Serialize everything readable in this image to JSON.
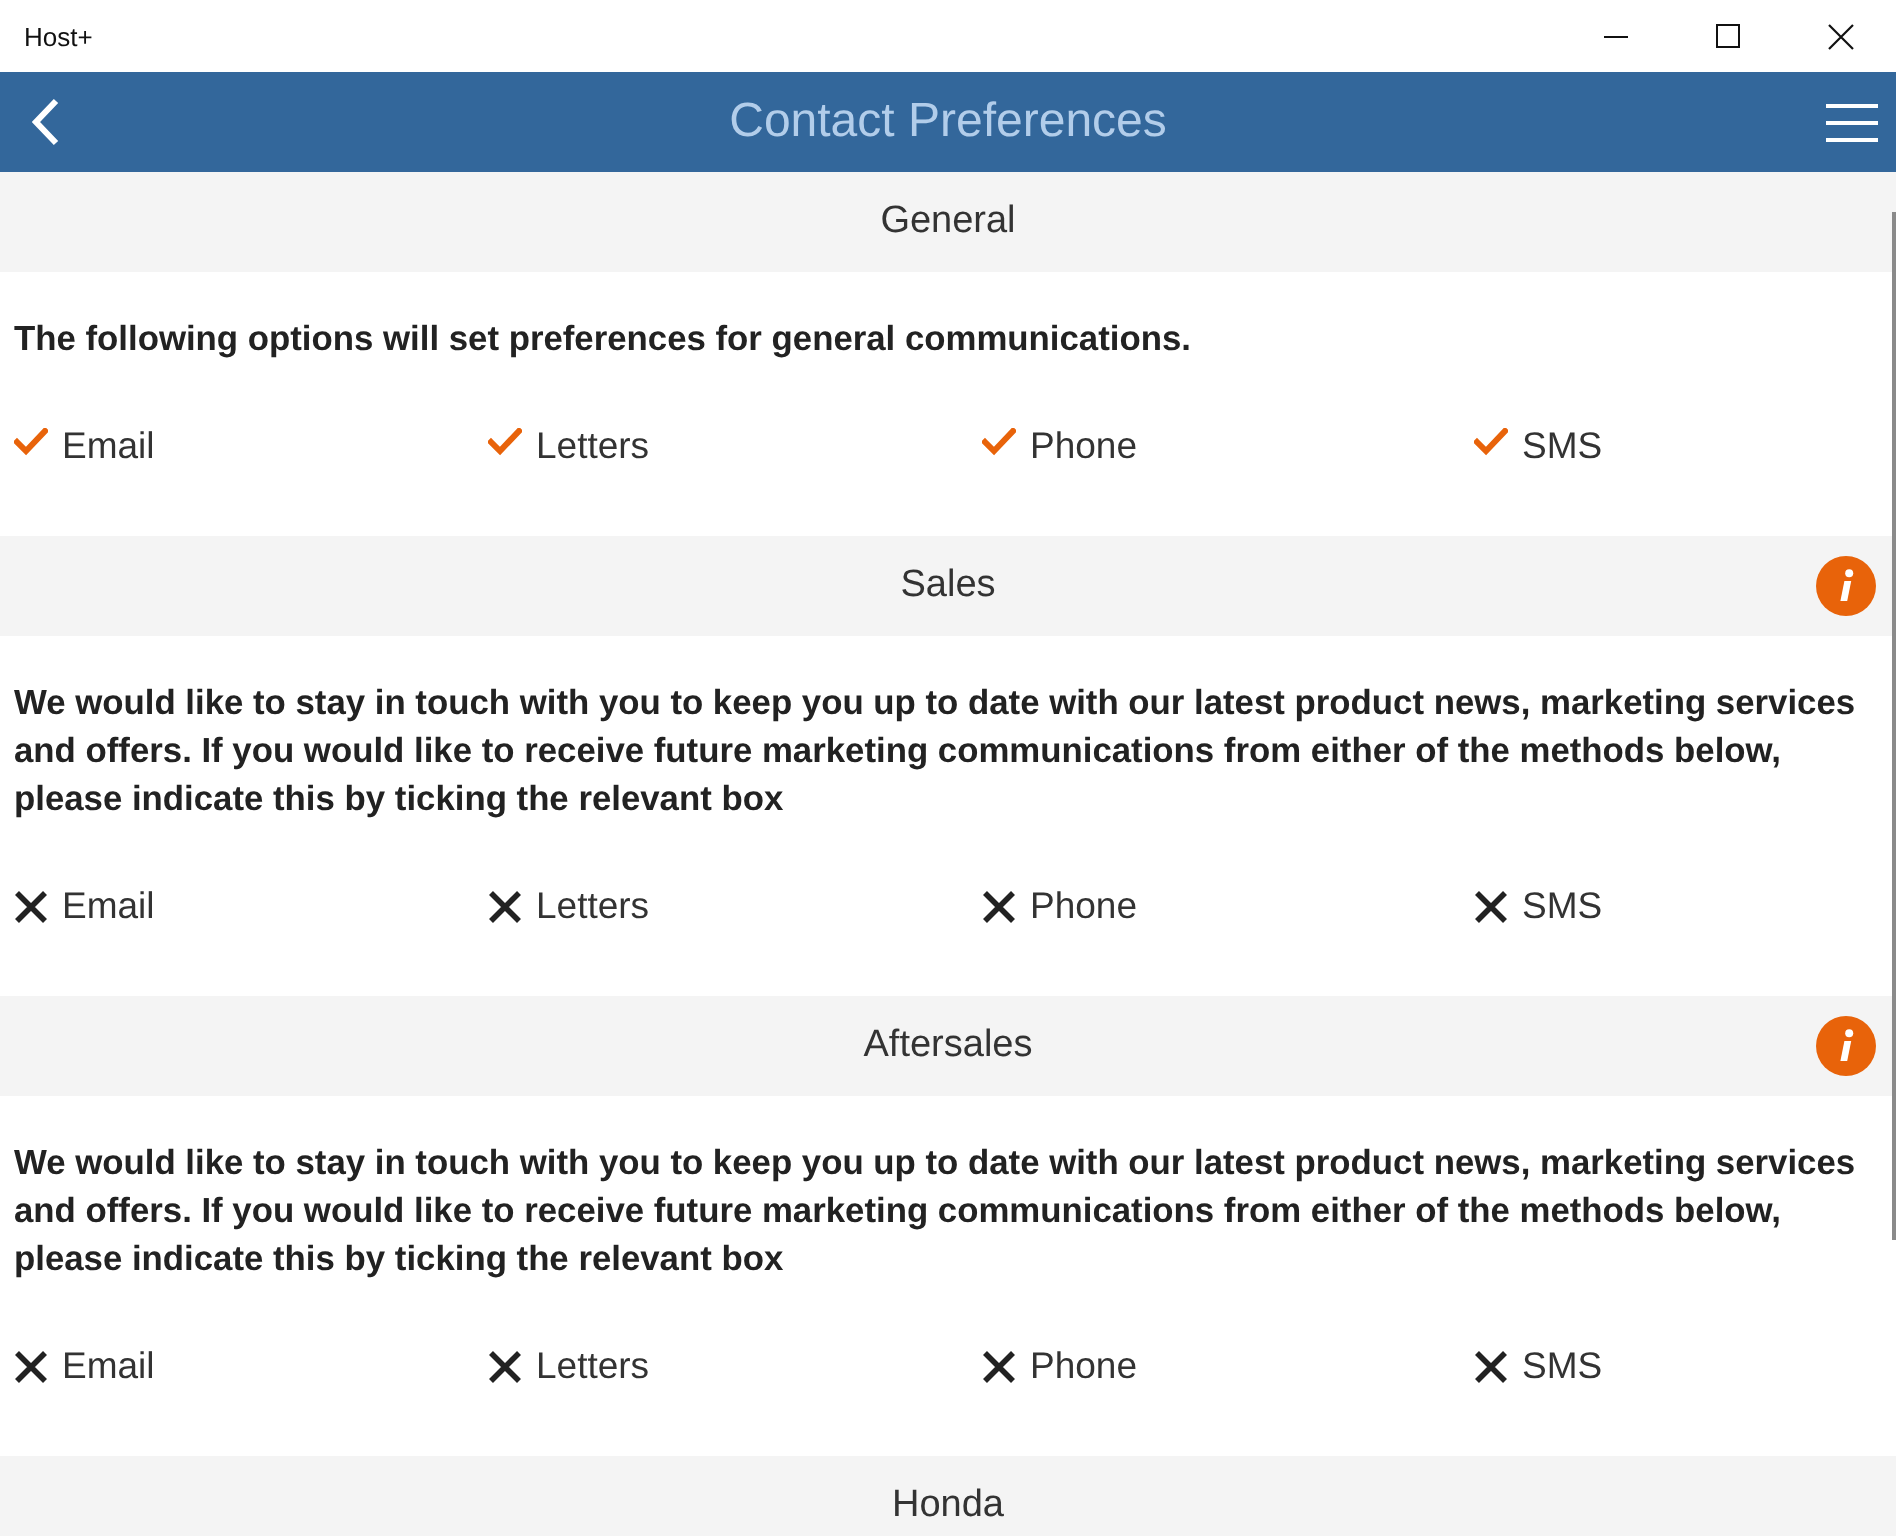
{
  "window": {
    "title": "Host+"
  },
  "header": {
    "title": "Contact Preferences"
  },
  "sections": [
    {
      "title": "General",
      "info": false,
      "description": "The following options will set preferences for general communications.",
      "options": [
        {
          "label": "Email",
          "checked": true
        },
        {
          "label": "Letters",
          "checked": true
        },
        {
          "label": "Phone",
          "checked": true
        },
        {
          "label": "SMS",
          "checked": true
        }
      ]
    },
    {
      "title": "Sales",
      "info": true,
      "description": "We would like to stay in touch with you to keep you up to date with our latest product news, marketing services and offers. If you would like to receive future marketing communications from either of the methods below, please indicate this by ticking the relevant box",
      "options": [
        {
          "label": "Email",
          "checked": false
        },
        {
          "label": "Letters",
          "checked": false
        },
        {
          "label": "Phone",
          "checked": false
        },
        {
          "label": "SMS",
          "checked": false
        }
      ]
    },
    {
      "title": "Aftersales",
      "info": true,
      "description": "We would like to stay in touch with you to keep you up to date with our latest product news, marketing services and offers. If you would like to receive future marketing communications from either of the methods below, please indicate this by ticking the relevant box",
      "options": [
        {
          "label": "Email",
          "checked": false
        },
        {
          "label": "Letters",
          "checked": false
        },
        {
          "label": "Phone",
          "checked": false
        },
        {
          "label": "SMS",
          "checked": false
        }
      ]
    },
    {
      "title": "Honda",
      "info": false
    }
  ]
}
